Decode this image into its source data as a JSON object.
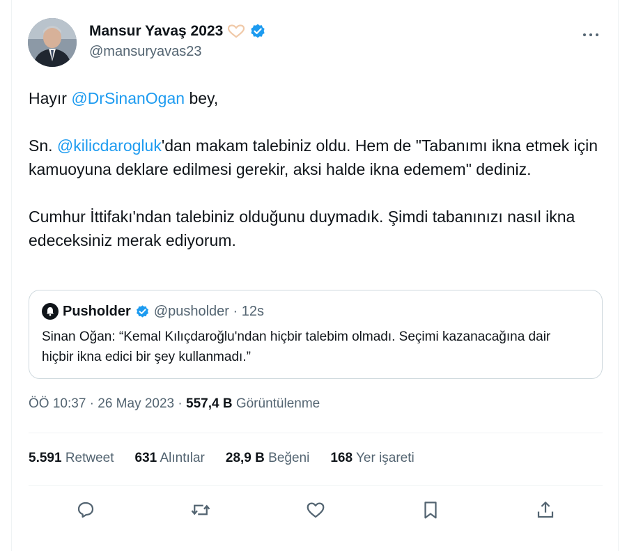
{
  "author": {
    "name": "Mansur Yavaş 2023",
    "handle": "@mansuryavas23"
  },
  "menu_icon": "more-horizontal-icon",
  "tweet": {
    "para1": {
      "before": "Hayır ",
      "mention": "@DrSinanOgan",
      "after": " bey,"
    },
    "para2": {
      "before": "Sn. ",
      "mention": "@kilicdarogluk",
      "after": "'dan makam talebiniz oldu. Hem de \"Tabanımı ikna etmek için kamuoyuna deklare edilmesi gerekir, aksi halde ikna edemem\" dediniz."
    },
    "para3": "Cumhur İttifakı'ndan talebiniz olduğunu duymadık. Şimdi tabanınızı nasıl ikna edeceksiniz merak ediyorum."
  },
  "quote": {
    "name": "Pusholder",
    "handle": "@pusholder · 12s",
    "text": "Sinan Oğan: “Kemal Kılıçdaroğlu'ndan hiçbir talebim olmadı. Seçimi kazanacağına dair hiçbir ikna edici bir şey kullanmadı.”"
  },
  "meta": {
    "time": "ÖÖ 10:37 · 26 May 2023 · ",
    "views": "557,4 B",
    "views_label": " Görüntülenme"
  },
  "stats": [
    {
      "value": "5.591",
      "label": " Retweet"
    },
    {
      "value": "631",
      "label": " Alıntılar"
    },
    {
      "value": "28,9 B",
      "label": " Beğeni"
    },
    {
      "value": "168",
      "label": " Yer işareti"
    }
  ],
  "actions": [
    "reply-icon",
    "retweet-icon",
    "like-icon",
    "bookmark-icon",
    "share-icon"
  ],
  "colors": {
    "link": "#1d9bf0",
    "secondary": "#536471",
    "text": "#0f1419",
    "border": "#cfd9de"
  }
}
